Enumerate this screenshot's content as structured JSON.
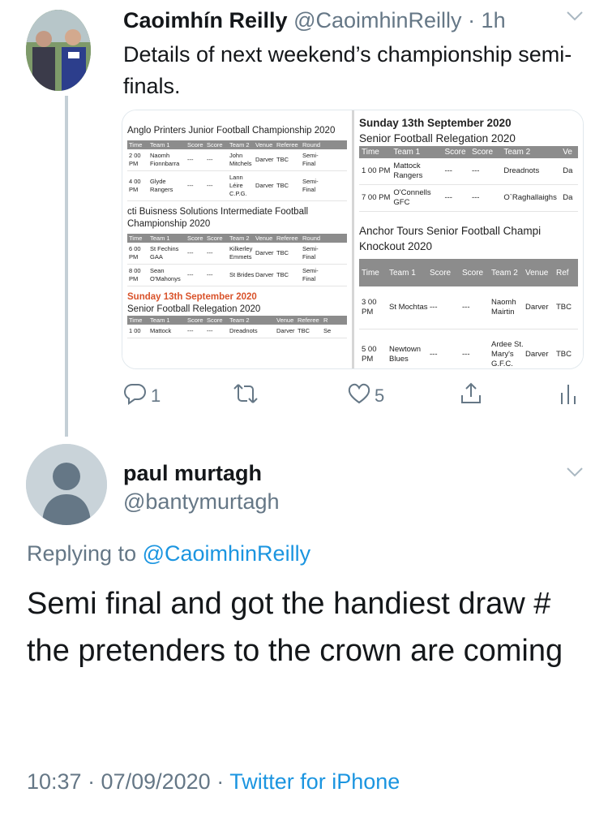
{
  "tweet": {
    "name": "Caoimhín Reilly",
    "handle": "@CaoimhinReilly",
    "time": "· 1h",
    "text": "Details of next weekend’s championship semi-finals.",
    "reply_count": "1",
    "like_count": "5"
  },
  "media": {
    "left": {
      "junior": {
        "title": "Anglo Printers Junior Football Championship 2020",
        "headers": [
          "Time",
          "Team 1",
          "Score",
          "Score",
          "Team 2",
          "Venue",
          "Referee",
          "Round"
        ],
        "rows": [
          [
            "2 00 PM",
            "Naomh Fionnbarra",
            "---",
            "---",
            "John Mitchels",
            "Darver",
            "TBC",
            "Semi-Final"
          ],
          [
            "4 00 PM",
            "Glyde Rangers",
            "---",
            "---",
            "Lann Léire C.P.G.",
            "Darver",
            "TBC",
            "Semi-Final"
          ]
        ]
      },
      "intermediate": {
        "title": "cti Buisness Solutions Intermediate Football Championship 2020",
        "headers": [
          "Time",
          "Team 1",
          "Score",
          "Score",
          "Team 2",
          "Venue",
          "Referee",
          "Round"
        ],
        "rows": [
          [
            "6 00 PM",
            "St Fechins GAA",
            "---",
            "---",
            "Kilkerley Emmets",
            "Darver",
            "TBC",
            "Semi-Final"
          ],
          [
            "8 00 PM",
            "Sean O'Mahonys",
            "---",
            "---",
            "St Brides",
            "Darver",
            "TBC",
            "Semi-Final"
          ]
        ]
      },
      "relegation": {
        "date": "Sunday 13th September 2020",
        "title": "Senior Football Relegation 2020",
        "headers": [
          "Time",
          "Team 1",
          "Score",
          "Score",
          "Team 2",
          "Venue",
          "Referee",
          "R"
        ],
        "rows": [
          [
            "1 00",
            "Mattock",
            "---",
            "---",
            "Dreadnots",
            "Darver",
            "TBC",
            "Se"
          ]
        ]
      }
    },
    "right": {
      "relegation": {
        "date": "Sunday 13th September 2020",
        "title": "Senior Football Relegation 2020",
        "headers": [
          "Time",
          "Team 1",
          "Score",
          "Score",
          "Team 2",
          "Ve"
        ],
        "rows": [
          [
            "1 00 PM",
            "Mattock Rangers",
            "---",
            "---",
            "Dreadnots",
            "Da"
          ],
          [
            "7 00 PM",
            "O'Connells GFC",
            "---",
            "---",
            "O`Raghallaighs",
            "Da"
          ]
        ]
      },
      "senior": {
        "title": "Anchor Tours Senior Football Champi Knockout 2020",
        "headers": [
          "Time",
          "Team 1",
          "Score",
          "Score",
          "Team 2",
          "Venue",
          "Ref"
        ],
        "rows": [
          [
            "3 00 PM",
            "St Mochtas",
            "---",
            "---",
            "Naomh Mairtin",
            "Darver",
            "TBC"
          ],
          [
            "5 00 PM",
            "Newtown Blues",
            "---",
            "---",
            "Ardee St. Mary's G.F.C.",
            "Darver",
            "TBC"
          ]
        ]
      }
    }
  },
  "reply_tweet": {
    "name": "paul murtagh",
    "handle": "@bantymurtagh",
    "replying_prefix": "Replying to ",
    "replying_to": "@CaoimhinReilly",
    "text": "Semi final and got the handiest draw # the pretenders to the crown are coming",
    "timestamp": "10:37 · 07/09/2020 · ",
    "source": "Twitter for iPhone"
  },
  "icons": {
    "reply": "reply-icon",
    "retweet": "retweet-icon",
    "like": "heart-icon",
    "share": "share-icon",
    "analytics": "analytics-icon",
    "more": "chevron-down-icon"
  },
  "colors": {
    "link": "#1b95e0",
    "muted": "#657786",
    "sunday": "#d9532b"
  }
}
